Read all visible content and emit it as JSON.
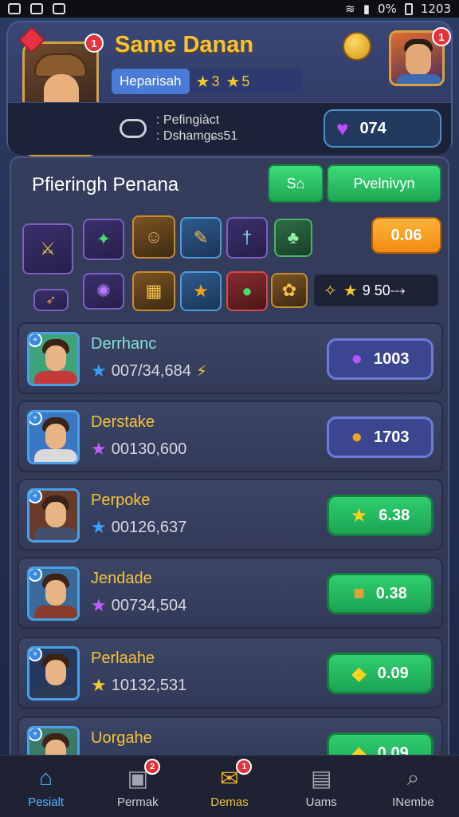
{
  "status_bar": {
    "right_text": "0% ",
    "time": "1203"
  },
  "header": {
    "game_title": "Same Danan",
    "avatar_badge": "1",
    "right_avatar_badge": "1",
    "tag_label": "Heparisah",
    "tag_value_1": "3",
    "tag_value_2": "5",
    "info_line_1": ": Pefingiàct",
    "info_line_2": ": Dshamgɕs51",
    "gem_value": "074"
  },
  "panel": {
    "title": "Pfieringh Penana",
    "button_small": "S⌂",
    "button_large": "Pvelnivyn",
    "orange_value": "0.06",
    "reward_value": "9 50⤏"
  },
  "rows": [
    {
      "name": "Derrhanc",
      "name_color": "#7fe6d8",
      "score": "007/34,684",
      "star_color": "#3aa0ff",
      "star_suffix": "⚡",
      "btn_value": "1003",
      "btn_style": "purple",
      "btn_icon": "●",
      "btn_icon_color": "#b455ff",
      "avatar_bg": "#3ea37a",
      "body_color": "#c43a3a"
    },
    {
      "name": "Derstake",
      "name_color": "#f5c23a",
      "score": "00130,600",
      "star_color": "#c35bff",
      "star_suffix": "",
      "btn_value": "1703",
      "btn_style": "purple",
      "btn_icon": "●",
      "btn_icon_color": "#f2a51f",
      "avatar_bg": "#3a78c4",
      "body_color": "#d9d9d9"
    },
    {
      "name": "Perpoke",
      "name_color": "#f5c23a",
      "score": "00126,637",
      "star_color": "#3aa0ff",
      "star_suffix": "",
      "btn_value": "6.38",
      "btn_style": "green",
      "btn_icon": "★",
      "btn_icon_color": "#ffd21f",
      "avatar_bg": "#6a3a2a",
      "body_color": "#44506b"
    },
    {
      "name": "Jendade",
      "name_color": "#f5c23a",
      "score": "00734,504",
      "star_color": "#c35bff",
      "star_suffix": "",
      "btn_value": "0.38",
      "btn_style": "green",
      "btn_icon": "■",
      "btn_icon_color": "#e0a03a",
      "avatar_bg": "#3a6a9a",
      "body_color": "#8a3a2a"
    },
    {
      "name": "Perlaahe",
      "name_color": "#f5c23a",
      "score": "10132,531",
      "star_color": "#f6c630",
      "star_suffix": "",
      "btn_value": "0.09",
      "btn_style": "green",
      "btn_icon": "◆",
      "btn_icon_color": "#ffd21f",
      "avatar_bg": "#25385e",
      "body_color": "#2d3a55"
    },
    {
      "name": "Uorgahe",
      "name_color": "#f5c23a",
      "score": "",
      "star_color": "#f6c630",
      "star_suffix": "",
      "btn_value": "0.09",
      "btn_style": "green",
      "btn_icon": "◆",
      "btn_icon_color": "#ffd21f",
      "avatar_bg": "#3a7a6a",
      "body_color": "#2d3a55"
    }
  ],
  "nav": [
    {
      "label": "Pesialt",
      "icon": "⌂",
      "badge": "",
      "icon_color": "#4fb4ff",
      "state": "active"
    },
    {
      "label": "Permak",
      "icon": "▣",
      "badge": "2",
      "icon_color": "#a0a4b0",
      "state": ""
    },
    {
      "label": "Demas",
      "icon": "✉",
      "badge": "1",
      "icon_color": "#f5b12a",
      "state": "gold"
    },
    {
      "label": "Uams",
      "icon": "▤",
      "badge": "",
      "icon_color": "#a0a4b0",
      "state": ""
    },
    {
      "label": "INembe",
      "icon": "⌕",
      "badge": "",
      "icon_color": "#a0a4b0",
      "state": ""
    }
  ],
  "colors": {
    "accent_gold": "#f5c23a",
    "accent_green": "#2fcf6e",
    "accent_purple": "#6e7ad9"
  }
}
